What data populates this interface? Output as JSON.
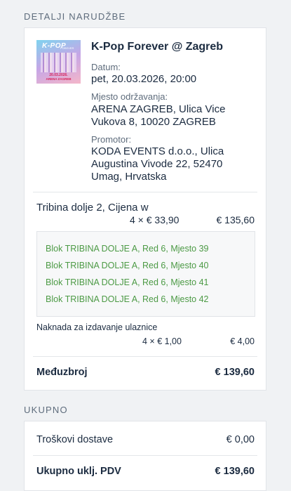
{
  "order_details": {
    "section_title": "DETALJI NARUDŽBE",
    "event": {
      "name": "K-Pop Forever @ Zagreb",
      "thumbnail_icon": "event-poster-thumbnail",
      "poster": {
        "title": "K-POP",
        "subtitle": "FOREVER",
        "date": "20.03.2026.",
        "venue": "ARENA ZAGREB"
      },
      "date_label": "Datum:",
      "date_value": "pet, 20.03.2026, 20:00",
      "venue_label": "Mjesto održavanja:",
      "venue_line1": "ARENA ZAGREB, Ulica Vice",
      "venue_line2": "Vukova 8, 10020 ZAGREB",
      "promoter_label": "Promotor:",
      "promoter_line1": "KODA EVENTS d.o.o., Ulica",
      "promoter_line2": "Augustina Vivode 22, 52470",
      "promoter_line3": "Umag, Hrvatska"
    },
    "ticket": {
      "title": "Tribina dolje 2, Cijena w",
      "quantity_price": "4 × € 33,90",
      "total": "€ 135,60",
      "seats": [
        "Blok TRIBINA DOLJE A, Red 6, Mjesto 39",
        "Blok TRIBINA DOLJE A, Red 6, Mjesto 40",
        "Blok TRIBINA DOLJE A, Red 6, Mjesto 41",
        "Blok TRIBINA DOLJE A, Red 6, Mjesto 42"
      ]
    },
    "fee": {
      "label": "Naknada za izdavanje ulaznice",
      "quantity_price": "4 × € 1,00",
      "total": "€ 4,00"
    },
    "subtotal": {
      "label": "Međuzbroj",
      "value": "€ 139,60"
    }
  },
  "totals": {
    "section_title": "UKUPNO",
    "delivery": {
      "label": "Troškovi dostave",
      "value": "€ 0,00"
    },
    "grand_total": {
      "label": "Ukupno uklj. PDV",
      "value": "€ 139,60"
    }
  },
  "colors": {
    "seat_text": "#4c9a45",
    "text_primary": "#1b2b40",
    "text_muted": "#5e6c7c",
    "background": "#f0f2f4"
  }
}
